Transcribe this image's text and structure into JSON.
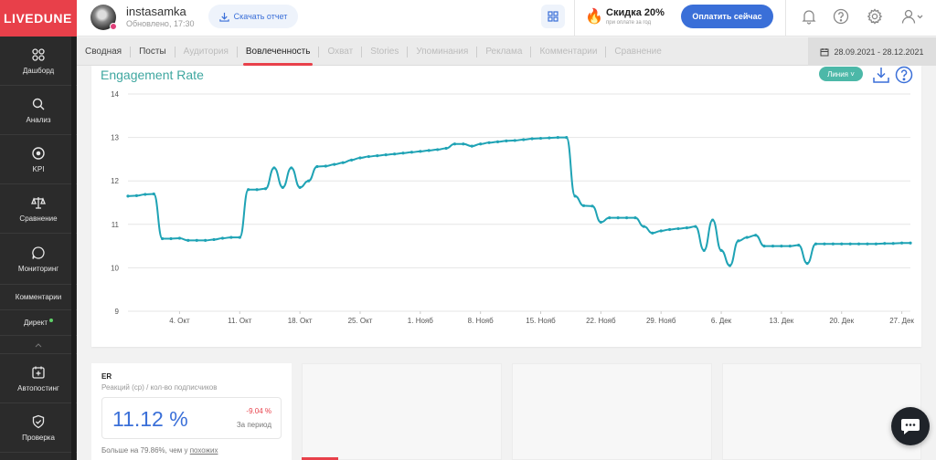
{
  "brand": {
    "logo": "LIVEDUNE"
  },
  "sidebar": {
    "items": [
      {
        "label": "Дашборд",
        "icon": "dashboard-icon"
      },
      {
        "label": "Анализ",
        "icon": "search-icon"
      },
      {
        "label": "KPI",
        "icon": "target-icon"
      },
      {
        "label": "Сравнение",
        "icon": "scales-icon"
      },
      {
        "label": "Мониторинг",
        "icon": "chat-bubble-icon"
      }
    ],
    "text_items": [
      {
        "label": "Комментарии"
      },
      {
        "label": "Директ"
      }
    ],
    "items_bottom": [
      {
        "label": "Автопостинг",
        "icon": "calendar-plus-icon"
      },
      {
        "label": "Проверка",
        "icon": "shield-check-icon"
      }
    ]
  },
  "header": {
    "account_name": "instasamka",
    "updated": "Обновлено, 17:30",
    "download_label": "Скачать отчет",
    "discount_title": "Скидка 20%",
    "discount_sub": "при оплате за год",
    "pay_label": "Оплатить сейчас"
  },
  "tabs": [
    {
      "label": "Сводная",
      "state": "normal"
    },
    {
      "label": "Посты",
      "state": "normal"
    },
    {
      "label": "Аудитория",
      "state": "disabled"
    },
    {
      "label": "Вовлеченность",
      "state": "current"
    },
    {
      "label": "Охват",
      "state": "disabled"
    },
    {
      "label": "Stories",
      "state": "disabled"
    },
    {
      "label": "Упоминания",
      "state": "disabled"
    },
    {
      "label": "Реклама",
      "state": "disabled"
    },
    {
      "label": "Комментарии",
      "state": "disabled"
    },
    {
      "label": "Сравнение",
      "state": "disabled"
    }
  ],
  "date_range": "28.09.2021 - 28.12.2021",
  "chart_card": {
    "title": "Engagement Rate",
    "view_select": "Линия"
  },
  "chart_data": {
    "type": "line",
    "title": "Engagement Rate",
    "color": "#1fa3b5",
    "ylim": [
      9,
      14
    ],
    "yticks": [
      9,
      10,
      11,
      12,
      13,
      14
    ],
    "xticks": [
      "4. Окт",
      "11. Окт",
      "18. Окт",
      "25. Окт",
      "1. Нояб",
      "8. Нояб",
      "15. Нояб",
      "22. Нояб",
      "29. Нояб",
      "6. Дек",
      "13. Дек",
      "20. Дек",
      "27. Дек"
    ],
    "x_start": "2021-09-28",
    "x_end": "2021-12-28",
    "dates": [
      "2021-09-28",
      "2021-09-29",
      "2021-09-30",
      "2021-10-01",
      "2021-10-02",
      "2021-10-03",
      "2021-10-04",
      "2021-10-05",
      "2021-10-06",
      "2021-10-07",
      "2021-10-08",
      "2021-10-09",
      "2021-10-10",
      "2021-10-11",
      "2021-10-12",
      "2021-10-13",
      "2021-10-14",
      "2021-10-15",
      "2021-10-16",
      "2021-10-17",
      "2021-10-18",
      "2021-10-19",
      "2021-10-20",
      "2021-10-21",
      "2021-10-22",
      "2021-10-23",
      "2021-10-24",
      "2021-10-25",
      "2021-10-26",
      "2021-10-27",
      "2021-10-28",
      "2021-10-29",
      "2021-10-30",
      "2021-10-31",
      "2021-11-01",
      "2021-11-02",
      "2021-11-03",
      "2021-11-04",
      "2021-11-05",
      "2021-11-06",
      "2021-11-07",
      "2021-11-08",
      "2021-11-09",
      "2021-11-10",
      "2021-11-11",
      "2021-11-12",
      "2021-11-13",
      "2021-11-14",
      "2021-11-15",
      "2021-11-16",
      "2021-11-17",
      "2021-11-18",
      "2021-11-19",
      "2021-11-20",
      "2021-11-21",
      "2021-11-22",
      "2021-11-23",
      "2021-11-24",
      "2021-11-25",
      "2021-11-26",
      "2021-11-27",
      "2021-11-28",
      "2021-11-29",
      "2021-11-30",
      "2021-12-01",
      "2021-12-02",
      "2021-12-03",
      "2021-12-04",
      "2021-12-05",
      "2021-12-06",
      "2021-12-07",
      "2021-12-08",
      "2021-12-09",
      "2021-12-10",
      "2021-12-11",
      "2021-12-12",
      "2021-12-13",
      "2021-12-14",
      "2021-12-15",
      "2021-12-16",
      "2021-12-17",
      "2021-12-18",
      "2021-12-19",
      "2021-12-20",
      "2021-12-21",
      "2021-12-22",
      "2021-12-23",
      "2021-12-24",
      "2021-12-25",
      "2021-12-26",
      "2021-12-27",
      "2021-12-28"
    ],
    "values": [
      11.65,
      11.66,
      11.69,
      11.7,
      10.67,
      10.67,
      10.68,
      10.63,
      10.63,
      10.63,
      10.65,
      10.68,
      10.7,
      10.7,
      11.8,
      11.8,
      11.82,
      12.3,
      11.85,
      12.3,
      11.85,
      12.0,
      12.33,
      12.34,
      12.38,
      12.42,
      12.48,
      12.53,
      12.56,
      12.58,
      12.6,
      12.62,
      12.64,
      12.66,
      12.68,
      12.7,
      12.72,
      12.75,
      12.85,
      12.85,
      12.8,
      12.85,
      12.88,
      12.9,
      12.92,
      12.93,
      12.95,
      12.97,
      12.98,
      12.99,
      13.0,
      13.0,
      11.65,
      11.43,
      11.42,
      11.05,
      11.15,
      11.15,
      11.15,
      11.15,
      10.95,
      10.8,
      10.85,
      10.88,
      10.9,
      10.92,
      10.95,
      10.4,
      11.1,
      10.4,
      10.05,
      10.62,
      10.7,
      10.75,
      10.5,
      10.5,
      10.5,
      10.5,
      10.52,
      10.1,
      10.55,
      10.55,
      10.55,
      10.55,
      10.55,
      10.55,
      10.55,
      10.55,
      10.56,
      10.56,
      10.57,
      10.57
    ]
  },
  "er_card": {
    "title": "ER",
    "subtitle": "Реакций (ср) / кол-во подписчиков",
    "value": "11.12 %",
    "change": "-9.04 %",
    "period_label": "За период",
    "compare_text": "Больше на 79.86%, чем у ",
    "compare_link": "похожих"
  }
}
